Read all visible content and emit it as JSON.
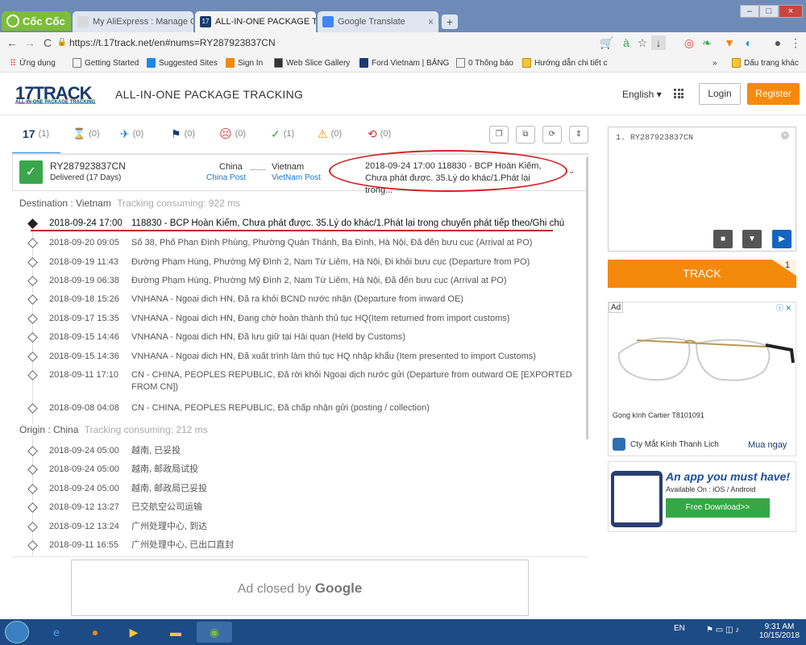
{
  "browser": {
    "name": "Cốc Cốc",
    "tabs": [
      {
        "title": "My AliExpress : Manage O",
        "favicon_color": "#d9d9d9"
      },
      {
        "title": "ALL-IN-ONE PACKAGE TRAC",
        "favicon_color": "#1a3a6e"
      },
      {
        "title": "Google Translate",
        "favicon_color": "#4285f4"
      }
    ],
    "url": "https://t.17track.net/en#nums=RY287923837CN",
    "bookmarks": [
      "Ứng dụng",
      "Getting Started",
      "Suggested Sites",
      "Sign In",
      "Web Slice Gallery",
      "Ford Vietnam | BẢNG",
      "0 Thông báo",
      "Hướng dẫn chi tiết c"
    ],
    "bookmarks_overflow": "»",
    "bookmarks_other": "Dấu trang khác"
  },
  "site": {
    "logo_num": "17",
    "logo_word": "TRACK",
    "logo_sub": "ALL-IN-ONE PACKAGE TRACKING",
    "title": "ALL-IN-ONE PACKAGE TRACKING",
    "language": "English ▾",
    "login": "Login",
    "register": "Register"
  },
  "status_tabs": [
    {
      "icon": "17",
      "name": "all",
      "count": "(1)",
      "color": "#1a3a6e"
    },
    {
      "icon": "⌛",
      "name": "not-found",
      "count": "(0)",
      "color": "#555555"
    },
    {
      "icon": "✈",
      "name": "in-transit",
      "count": "(0)",
      "color": "#1e88e5"
    },
    {
      "icon": "⚑",
      "name": "pick-up",
      "count": "(0)",
      "color": "#1a3a6e"
    },
    {
      "icon": "☹",
      "name": "undelivered",
      "count": "(0)",
      "color": "#e53935"
    },
    {
      "icon": "✓",
      "name": "delivered",
      "count": "(1)",
      "color": "#3aa64a"
    },
    {
      "icon": "⚠",
      "name": "alert",
      "count": "(0)",
      "color": "#f28a0b"
    },
    {
      "icon": "⟲",
      "name": "expired",
      "count": "(0)",
      "color": "#d32f2f"
    }
  ],
  "result": {
    "number": "RY287923837CN",
    "status": "Delivered (17 Days)",
    "origin_country": "China",
    "origin_carrier": "China Post",
    "dest_country": "Vietnam",
    "dest_carrier": "VietNam Post",
    "latest_line1": "2018-09-24 17:00  118830 - BCP Hoàn Kiếm,",
    "latest_line2": "Chưa phát được. 35.Lý do khác/1.Phát lại trong..."
  },
  "destination": {
    "label": "Destination : Vietnam",
    "meta": "Tracking consuming: 922 ms",
    "events": [
      {
        "time": "2018-09-24 17:00",
        "text": "118830 - BCP Hoàn Kiếm, Chưa phát được. 35.Lý do khác/1.Phát lại trong chuyến phát tiếp theo/Ghi chú"
      },
      {
        "time": "2018-09-20 09:05",
        "text": "Số 38, Phố Phan Đình Phùng, Phường Quán Thánh, Ba Đình, Hà Nội, Đã đến bưu cục (Arrival at PO)"
      },
      {
        "time": "2018-09-19 11:43",
        "text": "Đường Phạm Hùng, Phường Mỹ Đình 2, Nam Từ Liêm, Hà Nội, Đi khỏi bưu cục (Departure from PO)"
      },
      {
        "time": "2018-09-19 06:38",
        "text": "Đường Phạm Hùng, Phường Mỹ Đình 2, Nam Từ Liêm, Hà Nội, Đã đến bưu cục (Arrival at PO)"
      },
      {
        "time": "2018-09-18 15:26",
        "text": "VNHANA - Ngoai dich HN, Đã ra khỏi BCND nước nhận (Departure from inward OE)"
      },
      {
        "time": "2018-09-17 15:35",
        "text": "VNHANA - Ngoai dich HN, Đang chờ hoàn thành thủ tục HQ(Item returned from import customs)"
      },
      {
        "time": "2018-09-15 14:46",
        "text": "VNHANA - Ngoai dich HN, Đã lưu giữ tại Hải quan (Held by Customs)"
      },
      {
        "time": "2018-09-15 14:36",
        "text": "VNHANA - Ngoai dich HN, Đã xuất trình làm thủ tục HQ nhập khẩu (Item presented to import Customs)"
      },
      {
        "time": "2018-09-11 17:10",
        "text": "CN - CHINA, PEOPLES REPUBLIC, Đã rời khỏi Ngoại dịch nước gửi (Departure from outward OE [EXPORTED FROM CN])"
      },
      {
        "time": "2018-09-08 04:08",
        "text": "CN - CHINA, PEOPLES REPUBLIC, Đã chấp nhận gửi (posting / collection)"
      }
    ]
  },
  "origin": {
    "label": "Origin : China",
    "meta": "Tracking consuming: 212 ms",
    "events": [
      {
        "time": "2018-09-24 05:00",
        "text": "越南, 已妥投"
      },
      {
        "time": "2018-09-24 05:00",
        "text": "越南, 邮政局试投"
      },
      {
        "time": "2018-09-24 05:00",
        "text": "越南, 邮政局已妥投"
      },
      {
        "time": "2018-09-12 13:27",
        "text": "已交航空公司运输"
      },
      {
        "time": "2018-09-12 13:24",
        "text": "广州处理中心, 到达"
      },
      {
        "time": "2018-09-11 16:55",
        "text": "广州处理中心, 已出口直封"
      }
    ]
  },
  "ad_closed": {
    "text": "Ad closed by",
    "brand": "Google"
  },
  "sidebar": {
    "input_value": "1. RY287923837CN",
    "track_label": "TRACK",
    "track_count": "1",
    "ad_tag": "Ad",
    "ad_product": "Gọng kính Cartier T8101091",
    "ad_source": "Cty Mắt Kính Thanh Lịch",
    "ad_buy": "Mua ngay",
    "app_title": "An app you must have!",
    "app_sub": "Available On : iOS / Android",
    "app_button": "Free Download>>"
  },
  "taskbar": {
    "lang": "EN",
    "time": "9:31 AM",
    "date": "10/15/2018"
  }
}
